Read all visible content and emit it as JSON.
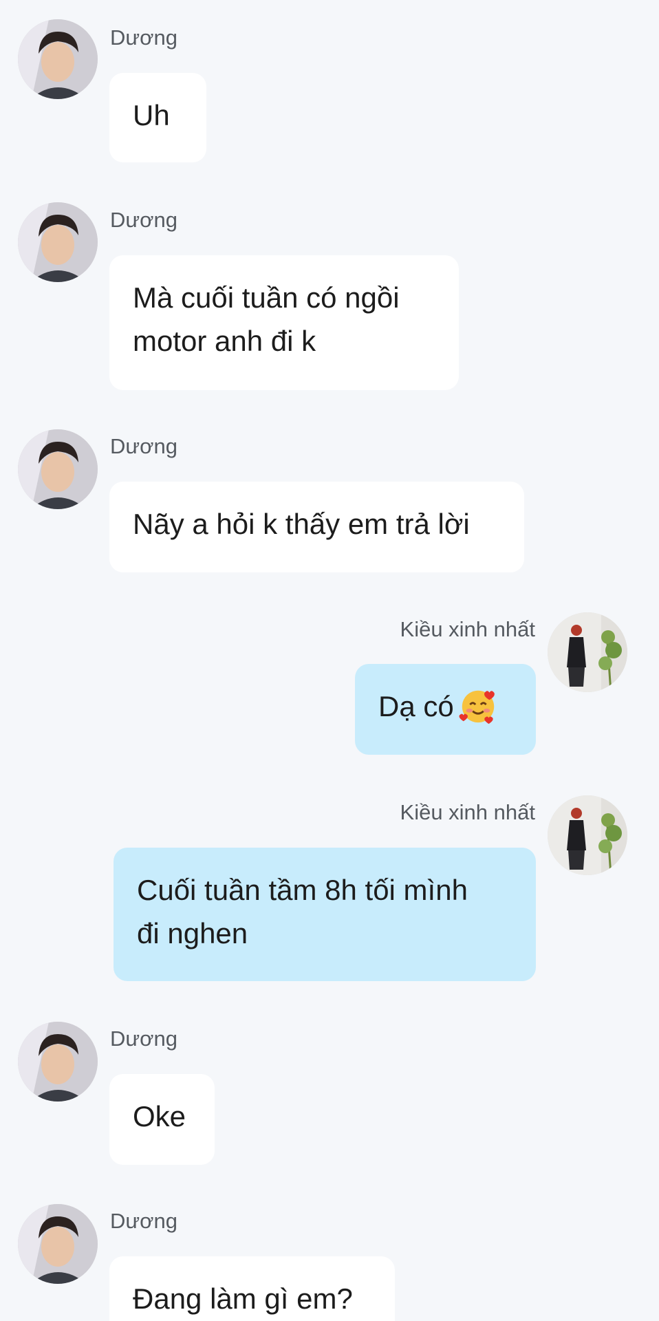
{
  "messages": [
    {
      "sender": "Dương",
      "lines": [
        "Uh"
      ]
    },
    {
      "sender": "Dương",
      "lines": [
        "Mà cuối tuần có ngồi",
        "motor anh đi k"
      ]
    },
    {
      "sender": "Dương",
      "lines": [
        "Nãy a hỏi k thấy em trả lời"
      ]
    },
    {
      "sender": "Kiều xinh nhất",
      "text": "Dạ có",
      "emoji": "smiling-face-with-hearts-icon"
    },
    {
      "sender": "Kiều xinh nhất",
      "lines": [
        "Cuối tuần tầm 8h tối mình",
        "đi nghen"
      ]
    },
    {
      "sender": "Dương",
      "lines": [
        "Oke"
      ]
    },
    {
      "sender": "Dương",
      "lines": [
        "Đang làm gì em?"
      ]
    }
  ],
  "colors": {
    "background": "#f5f7fa",
    "incoming_bubble": "#ffffff",
    "outgoing_bubble": "#c8ecfc",
    "sender_name": "#555a60"
  }
}
